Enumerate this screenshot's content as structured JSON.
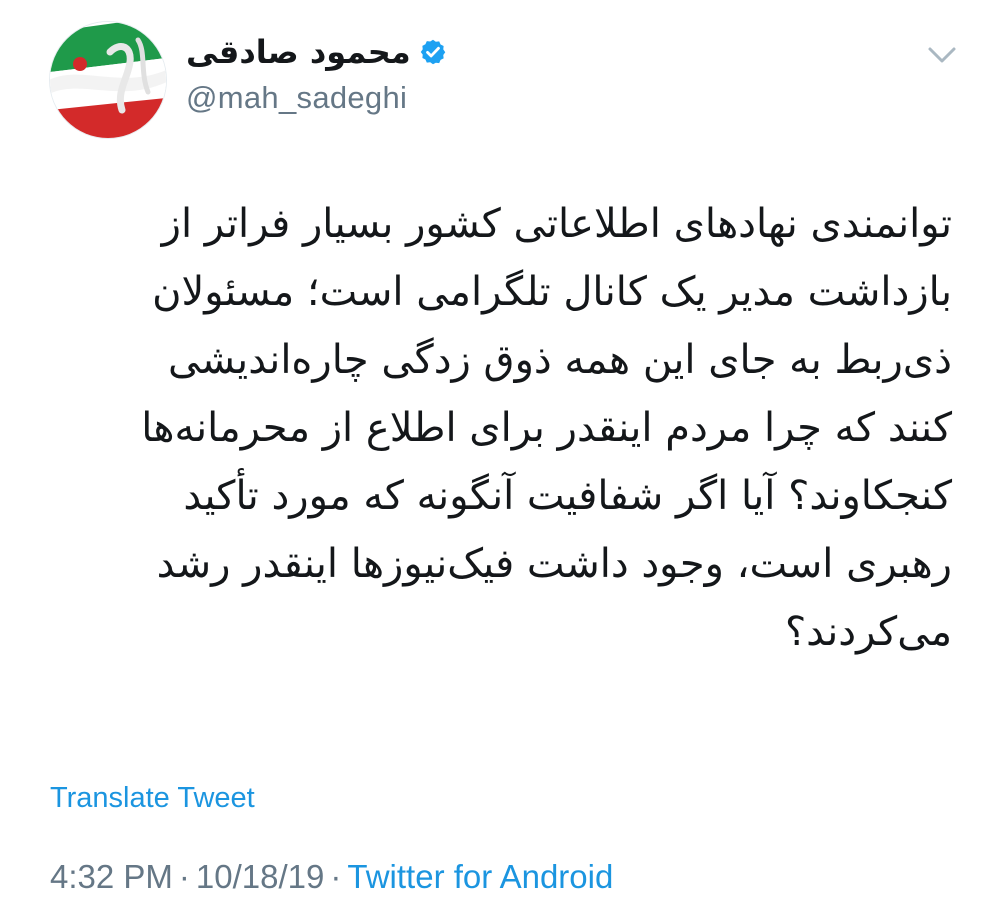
{
  "tweet": {
    "author": {
      "display_name": "محمود صادقی",
      "handle": "@mah_sadeghi",
      "verified": true,
      "avatar_icon": "iran-flag-avatar-icon"
    },
    "text_lines": [
      "توانمندی نهادهای اطلاعاتی کشور بسیار فراتر از",
      "بازداشت مدیر یک کانال تلگرامی است؛ مسئولان",
      "ذی‌ربط به جای این همه ذوق زدگی چاره‌اندیشی",
      "کنند که چرا مردم اینقدر برای اطلاع از محرمانه‌ها",
      "کنجکاوند؟ آیا اگر شفافیت آنگونه که مورد تأکید",
      "رهبری است، وجود داشت فیک‌نیوزها اینقدر رشد",
      "می‌کردند؟"
    ],
    "translate_label": "Translate Tweet",
    "time": "4:32 PM",
    "date": "10/18/19",
    "separator": "·",
    "source": "Twitter for Android",
    "menu_icon": "chevron-down-icon",
    "colors": {
      "link": "#1b95e0",
      "muted": "#657786",
      "text": "#14171a",
      "verified": "#1da1f2"
    }
  }
}
